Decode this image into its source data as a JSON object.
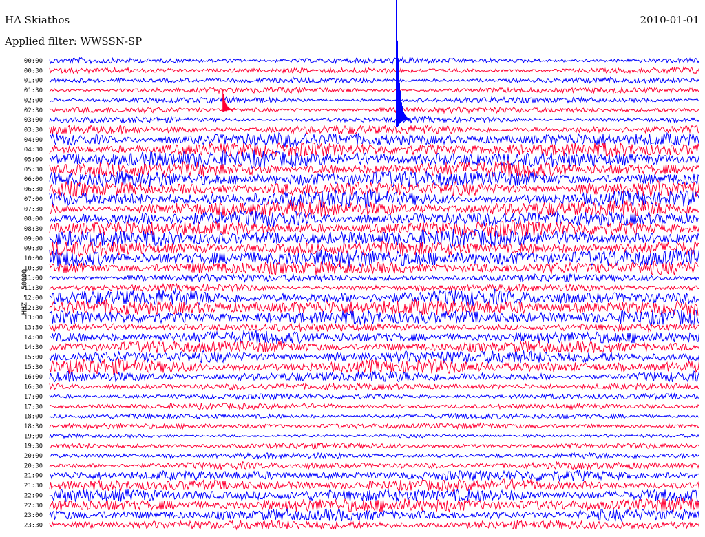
{
  "header": {
    "station": "HA Skiathos",
    "filter_prefix": "Applied filter:",
    "filter_name": "WWSSN-SP",
    "date": "2010-01-01"
  },
  "channel_label": "HHZ - 50000",
  "colors": {
    "trace_a": "#0000ff",
    "trace_b": "#ff0033",
    "background": "#ffffff",
    "text": "#111111"
  },
  "chart_data": {
    "type": "helicorder",
    "title": "HA Skiathos",
    "subtitle": "Applied filter: WWSSN-SP",
    "date": "2010-01-01",
    "ylabel": "HHZ - 50000",
    "line_interval_minutes": 30,
    "lines": [
      {
        "time": "00:00",
        "color": "blue",
        "amplitude": 3
      },
      {
        "time": "00:30",
        "color": "red",
        "amplitude": 3
      },
      {
        "time": "01:00",
        "color": "blue",
        "amplitude": 3
      },
      {
        "time": "01:30",
        "color": "red",
        "amplitude": 3
      },
      {
        "time": "02:00",
        "color": "blue",
        "amplitude": 3
      },
      {
        "time": "02:30",
        "color": "red",
        "amplitude": 3
      },
      {
        "time": "03:00",
        "color": "blue",
        "amplitude": 3
      },
      {
        "time": "03:30",
        "color": "red",
        "amplitude": 5
      },
      {
        "time": "04:00",
        "color": "blue",
        "amplitude": 8
      },
      {
        "time": "04:30",
        "color": "red",
        "amplitude": 8
      },
      {
        "time": "05:00",
        "color": "blue",
        "amplitude": 9
      },
      {
        "time": "05:30",
        "color": "red",
        "amplitude": 9
      },
      {
        "time": "06:00",
        "color": "blue",
        "amplitude": 9
      },
      {
        "time": "06:30",
        "color": "red",
        "amplitude": 9
      },
      {
        "time": "07:00",
        "color": "blue",
        "amplitude": 9
      },
      {
        "time": "07:30",
        "color": "red",
        "amplitude": 9
      },
      {
        "time": "08:00",
        "color": "blue",
        "amplitude": 9
      },
      {
        "time": "08:30",
        "color": "red",
        "amplitude": 9
      },
      {
        "time": "09:00",
        "color": "blue",
        "amplitude": 9
      },
      {
        "time": "09:30",
        "color": "red",
        "amplitude": 9
      },
      {
        "time": "10:00",
        "color": "blue",
        "amplitude": 10
      },
      {
        "time": "10:30",
        "color": "red",
        "amplitude": 8
      },
      {
        "time": "11:00",
        "color": "blue",
        "amplitude": 4
      },
      {
        "time": "11:30",
        "color": "red",
        "amplitude": 4
      },
      {
        "time": "12:00",
        "color": "blue",
        "amplitude": 9
      },
      {
        "time": "12:30",
        "color": "red",
        "amplitude": 10
      },
      {
        "time": "13:00",
        "color": "blue",
        "amplitude": 8
      },
      {
        "time": "13:30",
        "color": "red",
        "amplitude": 5
      },
      {
        "time": "14:00",
        "color": "blue",
        "amplitude": 7
      },
      {
        "time": "14:30",
        "color": "red",
        "amplitude": 7
      },
      {
        "time": "15:00",
        "color": "blue",
        "amplitude": 7
      },
      {
        "time": "15:30",
        "color": "red",
        "amplitude": 8
      },
      {
        "time": "16:00",
        "color": "blue",
        "amplitude": 6
      },
      {
        "time": "16:30",
        "color": "red",
        "amplitude": 4
      },
      {
        "time": "17:00",
        "color": "blue",
        "amplitude": 3
      },
      {
        "time": "17:30",
        "color": "red",
        "amplitude": 3
      },
      {
        "time": "18:00",
        "color": "blue",
        "amplitude": 3
      },
      {
        "time": "18:30",
        "color": "red",
        "amplitude": 3
      },
      {
        "time": "19:00",
        "color": "blue",
        "amplitude": 2
      },
      {
        "time": "19:30",
        "color": "red",
        "amplitude": 3
      },
      {
        "time": "20:00",
        "color": "blue",
        "amplitude": 3
      },
      {
        "time": "20:30",
        "color": "red",
        "amplitude": 4
      },
      {
        "time": "21:00",
        "color": "blue",
        "amplitude": 6
      },
      {
        "time": "21:30",
        "color": "red",
        "amplitude": 6
      },
      {
        "time": "22:00",
        "color": "blue",
        "amplitude": 8
      },
      {
        "time": "22:30",
        "color": "red",
        "amplitude": 8
      },
      {
        "time": "23:00",
        "color": "blue",
        "amplitude": 7
      },
      {
        "time": "23:30",
        "color": "red",
        "amplitude": 5
      }
    ],
    "events": [
      {
        "time": "03:00",
        "minute_offset": 16,
        "peak_amplitude": 190
      },
      {
        "time": "02:30",
        "minute_offset": 8,
        "peak_amplitude": 30
      }
    ]
  }
}
